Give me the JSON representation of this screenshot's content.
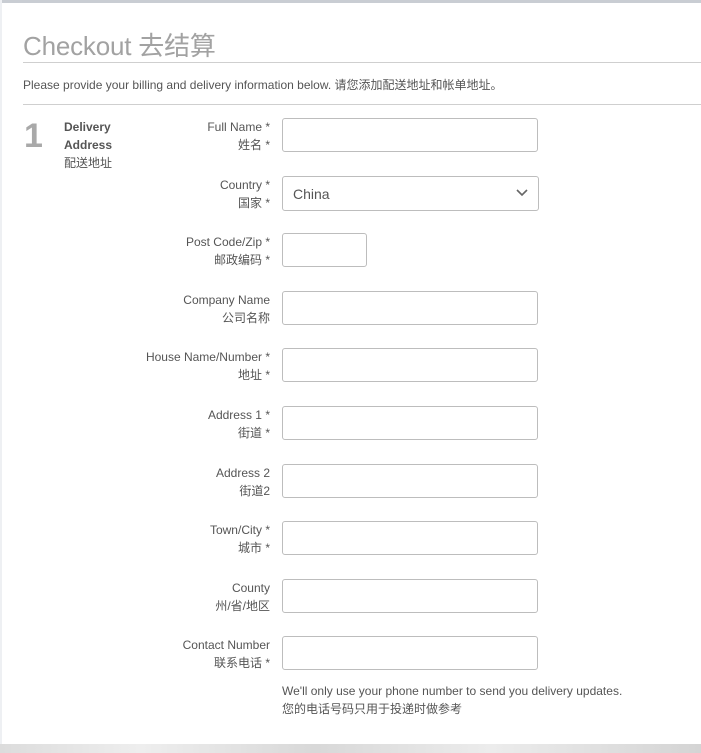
{
  "header": {
    "title": "Checkout 去结算",
    "intro": "Please provide your billing and delivery information below. 请您添加配送地址和帐单地址。"
  },
  "step": {
    "number": "1",
    "label_en": "Delivery Address",
    "label_zh": "配送地址"
  },
  "fields": {
    "full_name": {
      "label_en": "Full Name *",
      "label_zh": "姓名 *",
      "value": ""
    },
    "country": {
      "label_en": "Country *",
      "label_zh": "国家 *",
      "value": "China"
    },
    "post_code": {
      "label_en": "Post Code/Zip *",
      "label_zh": "邮政编码 *",
      "value": ""
    },
    "company_name": {
      "label_en": "Company Name",
      "label_zh": "公司名称",
      "value": ""
    },
    "house": {
      "label_en": "House Name/Number *",
      "label_zh": "地址 *",
      "value": ""
    },
    "address1": {
      "label_en": "Address 1 *",
      "label_zh": "街道 *",
      "value": ""
    },
    "address2": {
      "label_en": "Address 2",
      "label_zh": "街道2",
      "value": ""
    },
    "town": {
      "label_en": "Town/City *",
      "label_zh": "城市 *",
      "value": ""
    },
    "county": {
      "label_en": "County",
      "label_zh": "州/省/地区",
      "value": ""
    },
    "contact": {
      "label_en": "Contact Number",
      "label_zh": "联系电话 *",
      "value": ""
    }
  },
  "hint": {
    "en": "We'll only use your phone number to send you delivery updates.",
    "zh": "您的电话号码只用于投递时做参考"
  },
  "icons": {
    "country_dropdown": "chevron-down-icon"
  },
  "colors": {
    "title": "#a2a2a2",
    "text": "#555555",
    "border": "#bdbdbd",
    "rule": "#cfcfcf"
  }
}
